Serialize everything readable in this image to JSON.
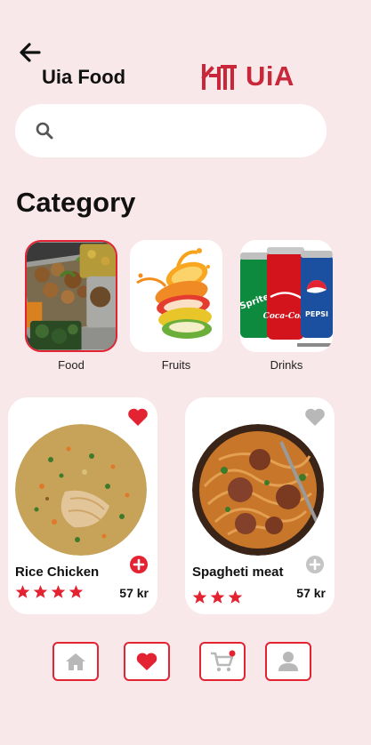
{
  "header": {
    "title": "Uia Food",
    "logo_text": "UiA",
    "back_icon": "arrow-left-icon"
  },
  "search": {
    "placeholder": "",
    "value": "",
    "icon": "search-icon"
  },
  "category_section": {
    "title": "Category",
    "items": [
      {
        "label": "Food",
        "selected": true
      },
      {
        "label": "Fruits",
        "selected": false
      },
      {
        "label": "Drinks",
        "selected": false
      }
    ]
  },
  "products": [
    {
      "name": "Rice Chicken",
      "price": "57 kr",
      "rating": 4,
      "favorite": true,
      "add_icon_active": true
    },
    {
      "name": "Spagheti meat",
      "price": "57 kr",
      "rating": 3,
      "favorite": false,
      "add_icon_active": false
    }
  ],
  "drink_brands": [
    "Sprite",
    "Coca-Cola",
    "Pepsi"
  ],
  "bottom_nav": {
    "items": [
      {
        "icon": "home-icon",
        "active": false
      },
      {
        "icon": "heart-icon",
        "active": true
      },
      {
        "icon": "cart-icon",
        "badge": true
      },
      {
        "icon": "profile-icon",
        "active": false
      }
    ]
  },
  "colors": {
    "background": "#f9e8ea",
    "accent": "#e32232",
    "logo": "#c8283a",
    "inactive_icon": "#b8b8b8"
  }
}
